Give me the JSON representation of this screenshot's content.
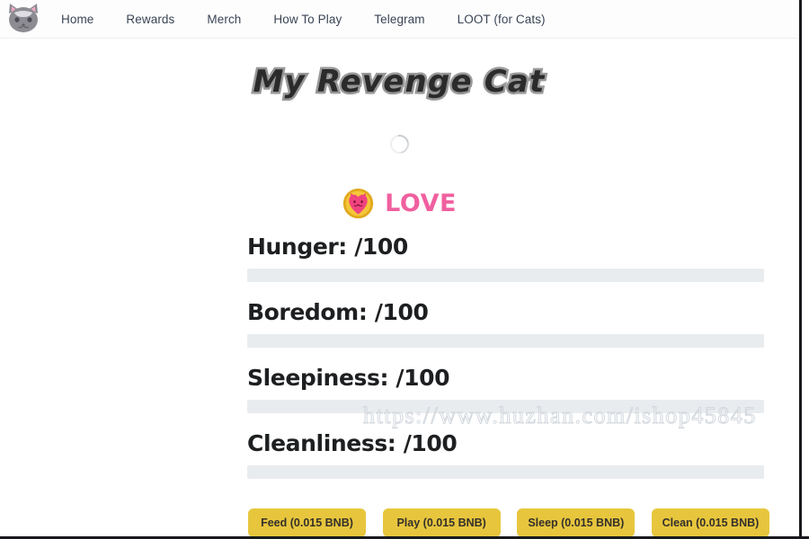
{
  "navbar": {
    "logo_icon": "cat-face-logo",
    "links": [
      {
        "label": "Home"
      },
      {
        "label": "Rewards"
      },
      {
        "label": "Merch"
      },
      {
        "label": "How To Play"
      },
      {
        "label": "Telegram"
      },
      {
        "label": "LOOT (for Cats)"
      }
    ]
  },
  "main": {
    "title": "My Revenge Cat",
    "loading_spinner": "loading-spinner",
    "token": {
      "icon": "love-coin-icon",
      "label": "LOVE"
    },
    "stats": [
      {
        "name": "hunger",
        "label": "Hunger: /100",
        "value": 0,
        "max": 100,
        "percent": 0
      },
      {
        "name": "boredom",
        "label": "Boredom: /100",
        "value": 0,
        "max": 100,
        "percent": 0
      },
      {
        "name": "sleepiness",
        "label": "Sleepiness: /100",
        "value": 0,
        "max": 100,
        "percent": 0
      },
      {
        "name": "cleanliness",
        "label": "Cleanliness: /100",
        "value": 0,
        "max": 100,
        "percent": 0
      }
    ],
    "actions": [
      {
        "name": "feed",
        "label": "Feed (0.015 BNB)"
      },
      {
        "name": "play",
        "label": "Play (0.015 BNB)"
      },
      {
        "name": "sleep",
        "label": "Sleep (0.015 BNB)"
      },
      {
        "name": "clean",
        "label": "Clean (0.015 BNB)"
      }
    ]
  },
  "watermark": {
    "text": "https://www.huzhan.com/ishop45845"
  },
  "colors": {
    "token_text": "#f0609f",
    "button_bg": "#e7c63d",
    "button_text": "#35302a",
    "progress_track": "#e9ecef",
    "nav_link": "#3a4454",
    "page_bg": "#ffffff"
  }
}
